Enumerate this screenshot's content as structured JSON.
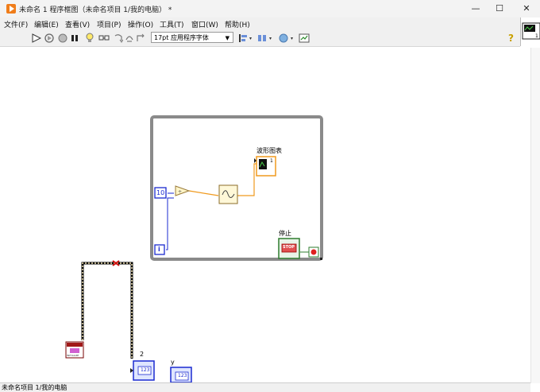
{
  "window": {
    "title": "未命名 1 程序框图（未命名项目 1/我的电脑） *",
    "minimize": "—",
    "maximize": "☐",
    "close": "✕"
  },
  "menubar": [
    "文件(F)",
    "编辑(E)",
    "查看(V)",
    "项目(P)",
    "操作(O)",
    "工具(T)",
    "窗口(W)",
    "帮助(H)"
  ],
  "toolbar": {
    "font": "17pt 应用程序字体",
    "help_icon": "?",
    "icons": [
      "run-arrow-icon",
      "run-continuously-icon",
      "abort-icon",
      "pause-icon",
      "highlight-execution-icon",
      "retain-wire-values-icon",
      "step-into-icon",
      "step-over-icon",
      "step-out-icon",
      "align-icon",
      "distribute-icon",
      "reorder-icon",
      "cleanup-icon"
    ]
  },
  "diagram": {
    "constant_10": "10",
    "loop_index": "i",
    "chart_label": "波形图表",
    "chart_terminal_text": "1",
    "stop_label": "停止",
    "stop_button_text": "STOP",
    "terminal_2_label": "2",
    "terminal_y_label": "y",
    "numeric_text": "123",
    "init_block_text": "INITIALIZE"
  },
  "status": {
    "project": "未命名项目 1/我的电脑"
  },
  "colors": {
    "app_orange": "#f07d1a",
    "while_loop_gray": "#8a8a8a",
    "numeric_blue": "#1a2ad0",
    "wire_orange": "#f09a1e",
    "boolean_green": "#2f7d2f",
    "error_red": "#d01010"
  }
}
